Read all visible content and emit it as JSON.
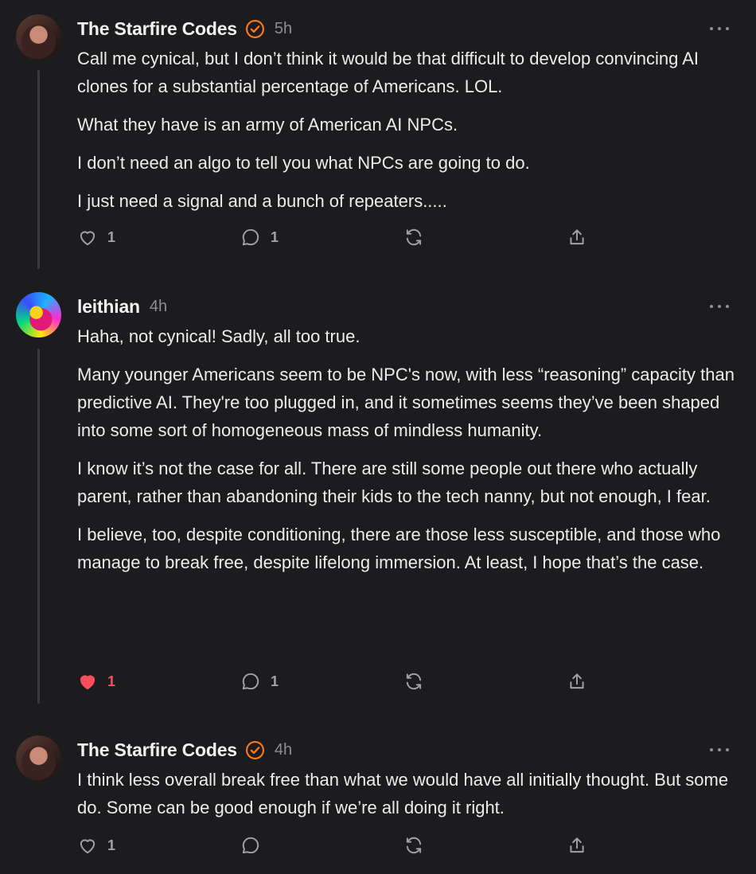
{
  "colors": {
    "background": "#1c1c1e",
    "accent": "#ff7a1a",
    "liked": "#ff4d5e",
    "muted": "#8e8e93"
  },
  "posts": [
    {
      "author": "The Starfire Codes",
      "verified": true,
      "time": "5h",
      "paragraphs": [
        "Call me cynical, but I don’t think it would be that difficult to develop convincing AI clones for a substantial percentage of Americans. LOL.",
        "What they have is an army of American AI NPCs.",
        "I don’t need an algo to tell you what NPCs are going to do.",
        "I just need a signal and a bunch of repeaters....."
      ],
      "likes": "1",
      "liked": false,
      "comments": "1"
    },
    {
      "author": "leithian",
      "verified": false,
      "time": "4h",
      "paragraphs": [
        "Haha, not cynical! Sadly, all too true.",
        "Many younger Americans seem to be NPC's now, with less “reasoning” capacity than predictive AI. They're too plugged in, and it sometimes seems they’ve been shaped into some sort of homogeneous mass of mindless humanity.",
        "I know it’s not the case for all. There are still some people out there who actually parent, rather than abandoning their kids to the tech nanny, but not enough, I fear.",
        "I believe, too, despite conditioning, there are those less susceptible, and those who manage to break free, despite lifelong immersion. At least, I hope that’s the case."
      ],
      "likes": "1",
      "liked": true,
      "comments": "1"
    },
    {
      "author": "The Starfire Codes",
      "verified": true,
      "time": "4h",
      "paragraphs": [
        "I think less overall break free than what we would have all initially thought. But some do. Some can be good enough if we’re all doing it right."
      ],
      "likes": "1",
      "liked": false,
      "comments": ""
    }
  ]
}
